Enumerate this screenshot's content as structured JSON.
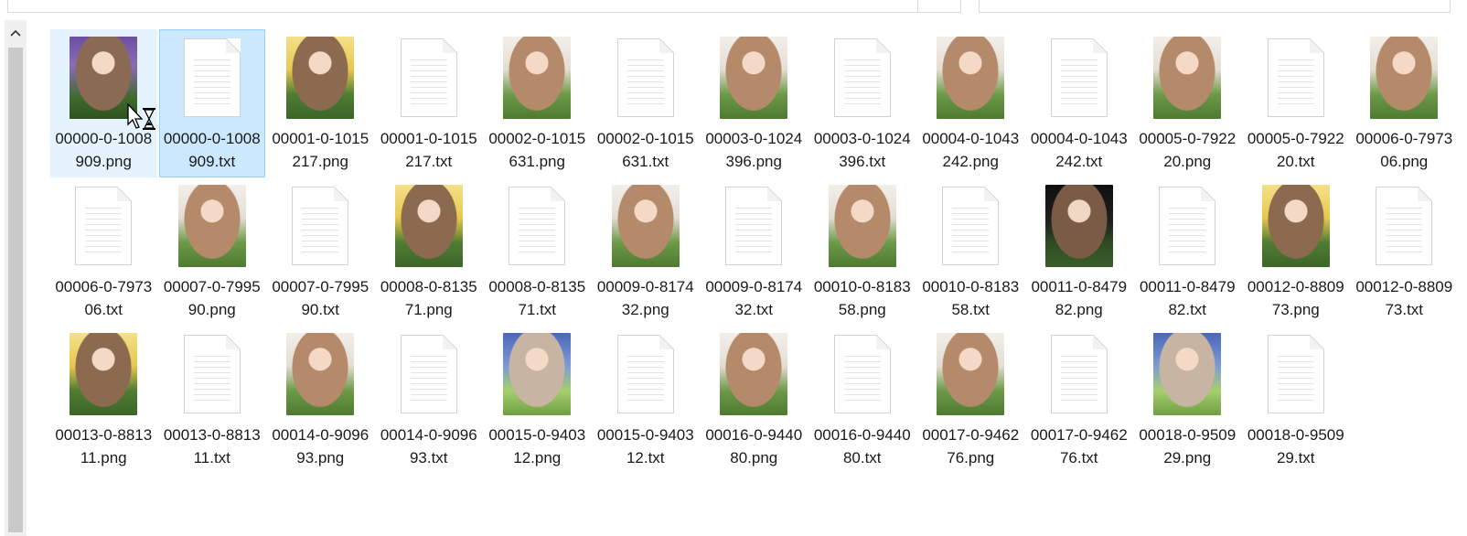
{
  "window": {
    "accent": "#cce8ff",
    "hover": "#e5f3ff"
  },
  "scrollbar": {
    "up_icon": "chevron-up-icon"
  },
  "cursor": {
    "icon": "busy-hourglass-cursor-icon"
  },
  "files": [
    {
      "name": "00000-0-1008909.png",
      "type": "image",
      "style": "purple",
      "state": "hover"
    },
    {
      "name": "00000-0-1008909.txt",
      "type": "text",
      "state": "selected"
    },
    {
      "name": "00001-0-1015217.png",
      "type": "image",
      "style": "yellow"
    },
    {
      "name": "00001-0-1015217.txt",
      "type": "text"
    },
    {
      "name": "00002-0-1015631.png",
      "type": "image",
      "style": "pale"
    },
    {
      "name": "00002-0-1015631.txt",
      "type": "text"
    },
    {
      "name": "00003-0-1024396.png",
      "type": "image",
      "style": "pale"
    },
    {
      "name": "00003-0-1024396.txt",
      "type": "text"
    },
    {
      "name": "00004-0-1043242.png",
      "type": "image",
      "style": "pale"
    },
    {
      "name": "00004-0-1043242.txt",
      "type": "text"
    },
    {
      "name": "00005-0-792220.png",
      "type": "image",
      "style": "pale"
    },
    {
      "name": "00005-0-792220.txt",
      "type": "text"
    },
    {
      "name": "00006-0-797306.png",
      "type": "image",
      "style": "pale"
    },
    {
      "name": "00006-0-797306.txt",
      "type": "text"
    },
    {
      "name": "00007-0-799590.png",
      "type": "image",
      "style": "pale"
    },
    {
      "name": "00007-0-799590.txt",
      "type": "text"
    },
    {
      "name": "00008-0-813571.png",
      "type": "image",
      "style": "yellow"
    },
    {
      "name": "00008-0-813571.txt",
      "type": "text"
    },
    {
      "name": "00009-0-817432.png",
      "type": "image",
      "style": "pale"
    },
    {
      "name": "00009-0-817432.txt",
      "type": "text"
    },
    {
      "name": "00010-0-818358.png",
      "type": "image",
      "style": "pale"
    },
    {
      "name": "00010-0-818358.txt",
      "type": "text"
    },
    {
      "name": "00011-0-847982.png",
      "type": "image",
      "style": "dark"
    },
    {
      "name": "00011-0-847982.txt",
      "type": "text"
    },
    {
      "name": "00012-0-880973.png",
      "type": "image",
      "style": "yellow"
    },
    {
      "name": "00012-0-880973.txt",
      "type": "text"
    },
    {
      "name": "00013-0-881311.png",
      "type": "image",
      "style": "yellow"
    },
    {
      "name": "00013-0-881311.txt",
      "type": "text"
    },
    {
      "name": "00014-0-909693.png",
      "type": "image",
      "style": "pale"
    },
    {
      "name": "00014-0-909693.txt",
      "type": "text"
    },
    {
      "name": "00015-0-940312.png",
      "type": "image",
      "style": "blue"
    },
    {
      "name": "00015-0-940312.txt",
      "type": "text"
    },
    {
      "name": "00016-0-944080.png",
      "type": "image",
      "style": "pale"
    },
    {
      "name": "00016-0-944080.txt",
      "type": "text"
    },
    {
      "name": "00017-0-946276.png",
      "type": "image",
      "style": "pale"
    },
    {
      "name": "00017-0-946276.txt",
      "type": "text"
    },
    {
      "name": "00018-0-950929.png",
      "type": "image",
      "style": "blue"
    },
    {
      "name": "00018-0-950929.txt",
      "type": "text"
    }
  ]
}
